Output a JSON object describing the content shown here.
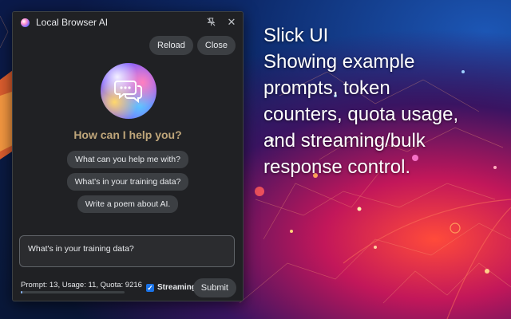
{
  "window": {
    "title": "Local Browser AI",
    "pin_icon": "pin-off-icon",
    "close_icon": "close-icon"
  },
  "toolbar": {
    "reload_label": "Reload",
    "close_label": "Close"
  },
  "assistant": {
    "avatar_icon": "chat-bubbles-icon",
    "greeting": "How can I help you?"
  },
  "suggestions": [
    "What can you help me with?",
    "What's in your training data?",
    "Write a poem about AI."
  ],
  "prompt": {
    "value": "What's in your training data?"
  },
  "counters": {
    "text": "Prompt: 13, Usage: 11, Quota: 9216",
    "prompt": 13,
    "usage": 11,
    "quota": 9216
  },
  "streaming": {
    "label": "Streaming",
    "checked": true
  },
  "submit_label": "Submit",
  "tagline": [
    "Slick UI",
    "Showing example",
    "prompts, token",
    "counters, quota usage,",
    "and streaming/bulk",
    "response control."
  ],
  "colors": {
    "accent": "#8ab4f8",
    "panel_bg": "#202124",
    "greeting": "#bfa67a",
    "checkbox": "#1a73e8"
  }
}
